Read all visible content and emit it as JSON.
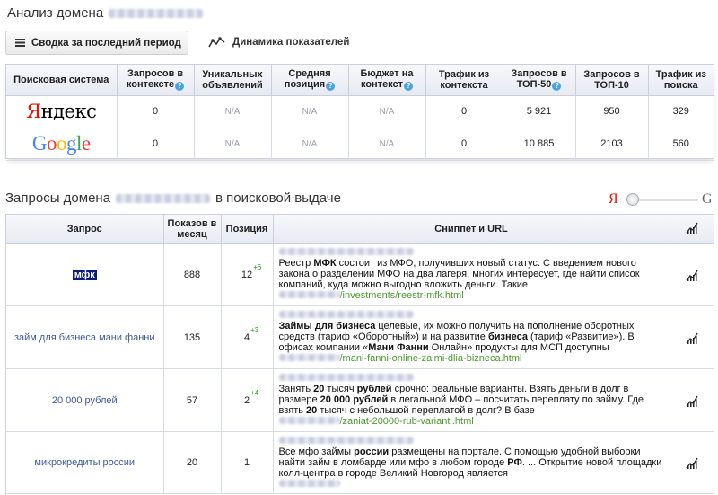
{
  "page": {
    "title": "Анализ домена",
    "tabs": [
      {
        "label": "Сводка за последний период",
        "icon": "list-icon",
        "active": true
      },
      {
        "label": "Динамика показателей",
        "icon": "trend-icon",
        "active": false
      }
    ]
  },
  "summary": {
    "headers": [
      "Поисковая система",
      "Запросов в контексте",
      "Уникальных объявлений",
      "Средняя позиция",
      "Бюджет на контекст",
      "Трафик из контекста",
      "Запросов в ТОП-50",
      "Запросов в ТОП-10",
      "Трафик из поиска"
    ],
    "rows": [
      {
        "engine_prefix": "Я",
        "engine_rest": "ндекс",
        "values": [
          "0",
          "N/A",
          "N/A",
          "N/A",
          "0",
          "5 921",
          "950",
          "329"
        ]
      },
      {
        "engine_letters": [
          "G",
          "o",
          "o",
          "g",
          "l",
          "e"
        ],
        "values": [
          "0",
          "N/A",
          "N/A",
          "N/A",
          "0",
          "10 885",
          "2103",
          "560"
        ]
      }
    ]
  },
  "queries": {
    "title_before": "Запросы домена",
    "title_after": "в поисковой выдаче",
    "slider": {
      "left": "Я",
      "right": "G"
    },
    "headers": [
      "Запрос",
      "Показов в месяц",
      "Позиция",
      "Сниппет и URL"
    ],
    "rows": [
      {
        "query": "мфк",
        "shows": "888",
        "position": "12",
        "delta": "+6",
        "snippet": [
          {
            "t": "Реестр "
          },
          {
            "t": "МФК",
            "b": true
          },
          {
            "t": " состоит из МФО, получивших новый статус. С введением нового закона о разделении МФО на два лагеря, многих интересует, где найти список компаний, куда можно выгодно вложить деньги. Такие"
          }
        ],
        "url": "/investments/reestr-mfk.html"
      },
      {
        "query": "займ для бизнеса мани фанни",
        "shows": "135",
        "position": "4",
        "delta": "+3",
        "snippet": [
          {
            "t": "Займы для бизнеса",
            "b": true
          },
          {
            "t": " целевые, их можно получить на пополнение оборотных средств (тариф «Оборотный») и на развитие "
          },
          {
            "t": "бизнеса",
            "b": true
          },
          {
            "t": " (тариф «Развитие»). В офисах компании «"
          },
          {
            "t": "Мани Фанни",
            "b": true
          },
          {
            "t": " Онлайн» продукты для МСП доступны"
          }
        ],
        "url": "/mani-fanni-online-zaimi-dlia-bizneca.html"
      },
      {
        "query": "20 000 рублей",
        "shows": "57",
        "position": "2",
        "delta": "+4",
        "snippet": [
          {
            "t": "Занять "
          },
          {
            "t": "20",
            "b": true
          },
          {
            "t": " тысяч "
          },
          {
            "t": "рублей",
            "b": true
          },
          {
            "t": " срочно: реальные варианты. Взять деньги в долг в размере "
          },
          {
            "t": "20 000 рублей",
            "b": true
          },
          {
            "t": " в легальной МФО – посчитать переплату по займу. Где взять "
          },
          {
            "t": "20",
            "b": true
          },
          {
            "t": " тысяч с небольшой переплатой в долг? В базе"
          }
        ],
        "url": "/zaniat-20000-rub-varianti.html"
      },
      {
        "query": "микрокредиты россии",
        "shows": "20",
        "position": "1",
        "delta": "",
        "snippet": [
          {
            "t": "Все мфо займы "
          },
          {
            "t": "россии",
            "b": true
          },
          {
            "t": " размещены на портале. С помощью удобной выборки найти займ в ломбарде или мфо в любом городе "
          },
          {
            "t": "РФ",
            "b": true
          },
          {
            "t": ". ... Открытие новой площадки колл-центра в городе Великий Новгород является"
          }
        ],
        "url": ""
      }
    ]
  },
  "colors": {
    "yandex_red": "#e61400",
    "google_blue": "#4285f4",
    "google_red": "#ea4335",
    "google_yellow": "#fbbc05",
    "google_green": "#34a853",
    "delta_green": "#1a9a1a",
    "url_green": "#4a9a2a",
    "link_blue": "#3b5998"
  }
}
